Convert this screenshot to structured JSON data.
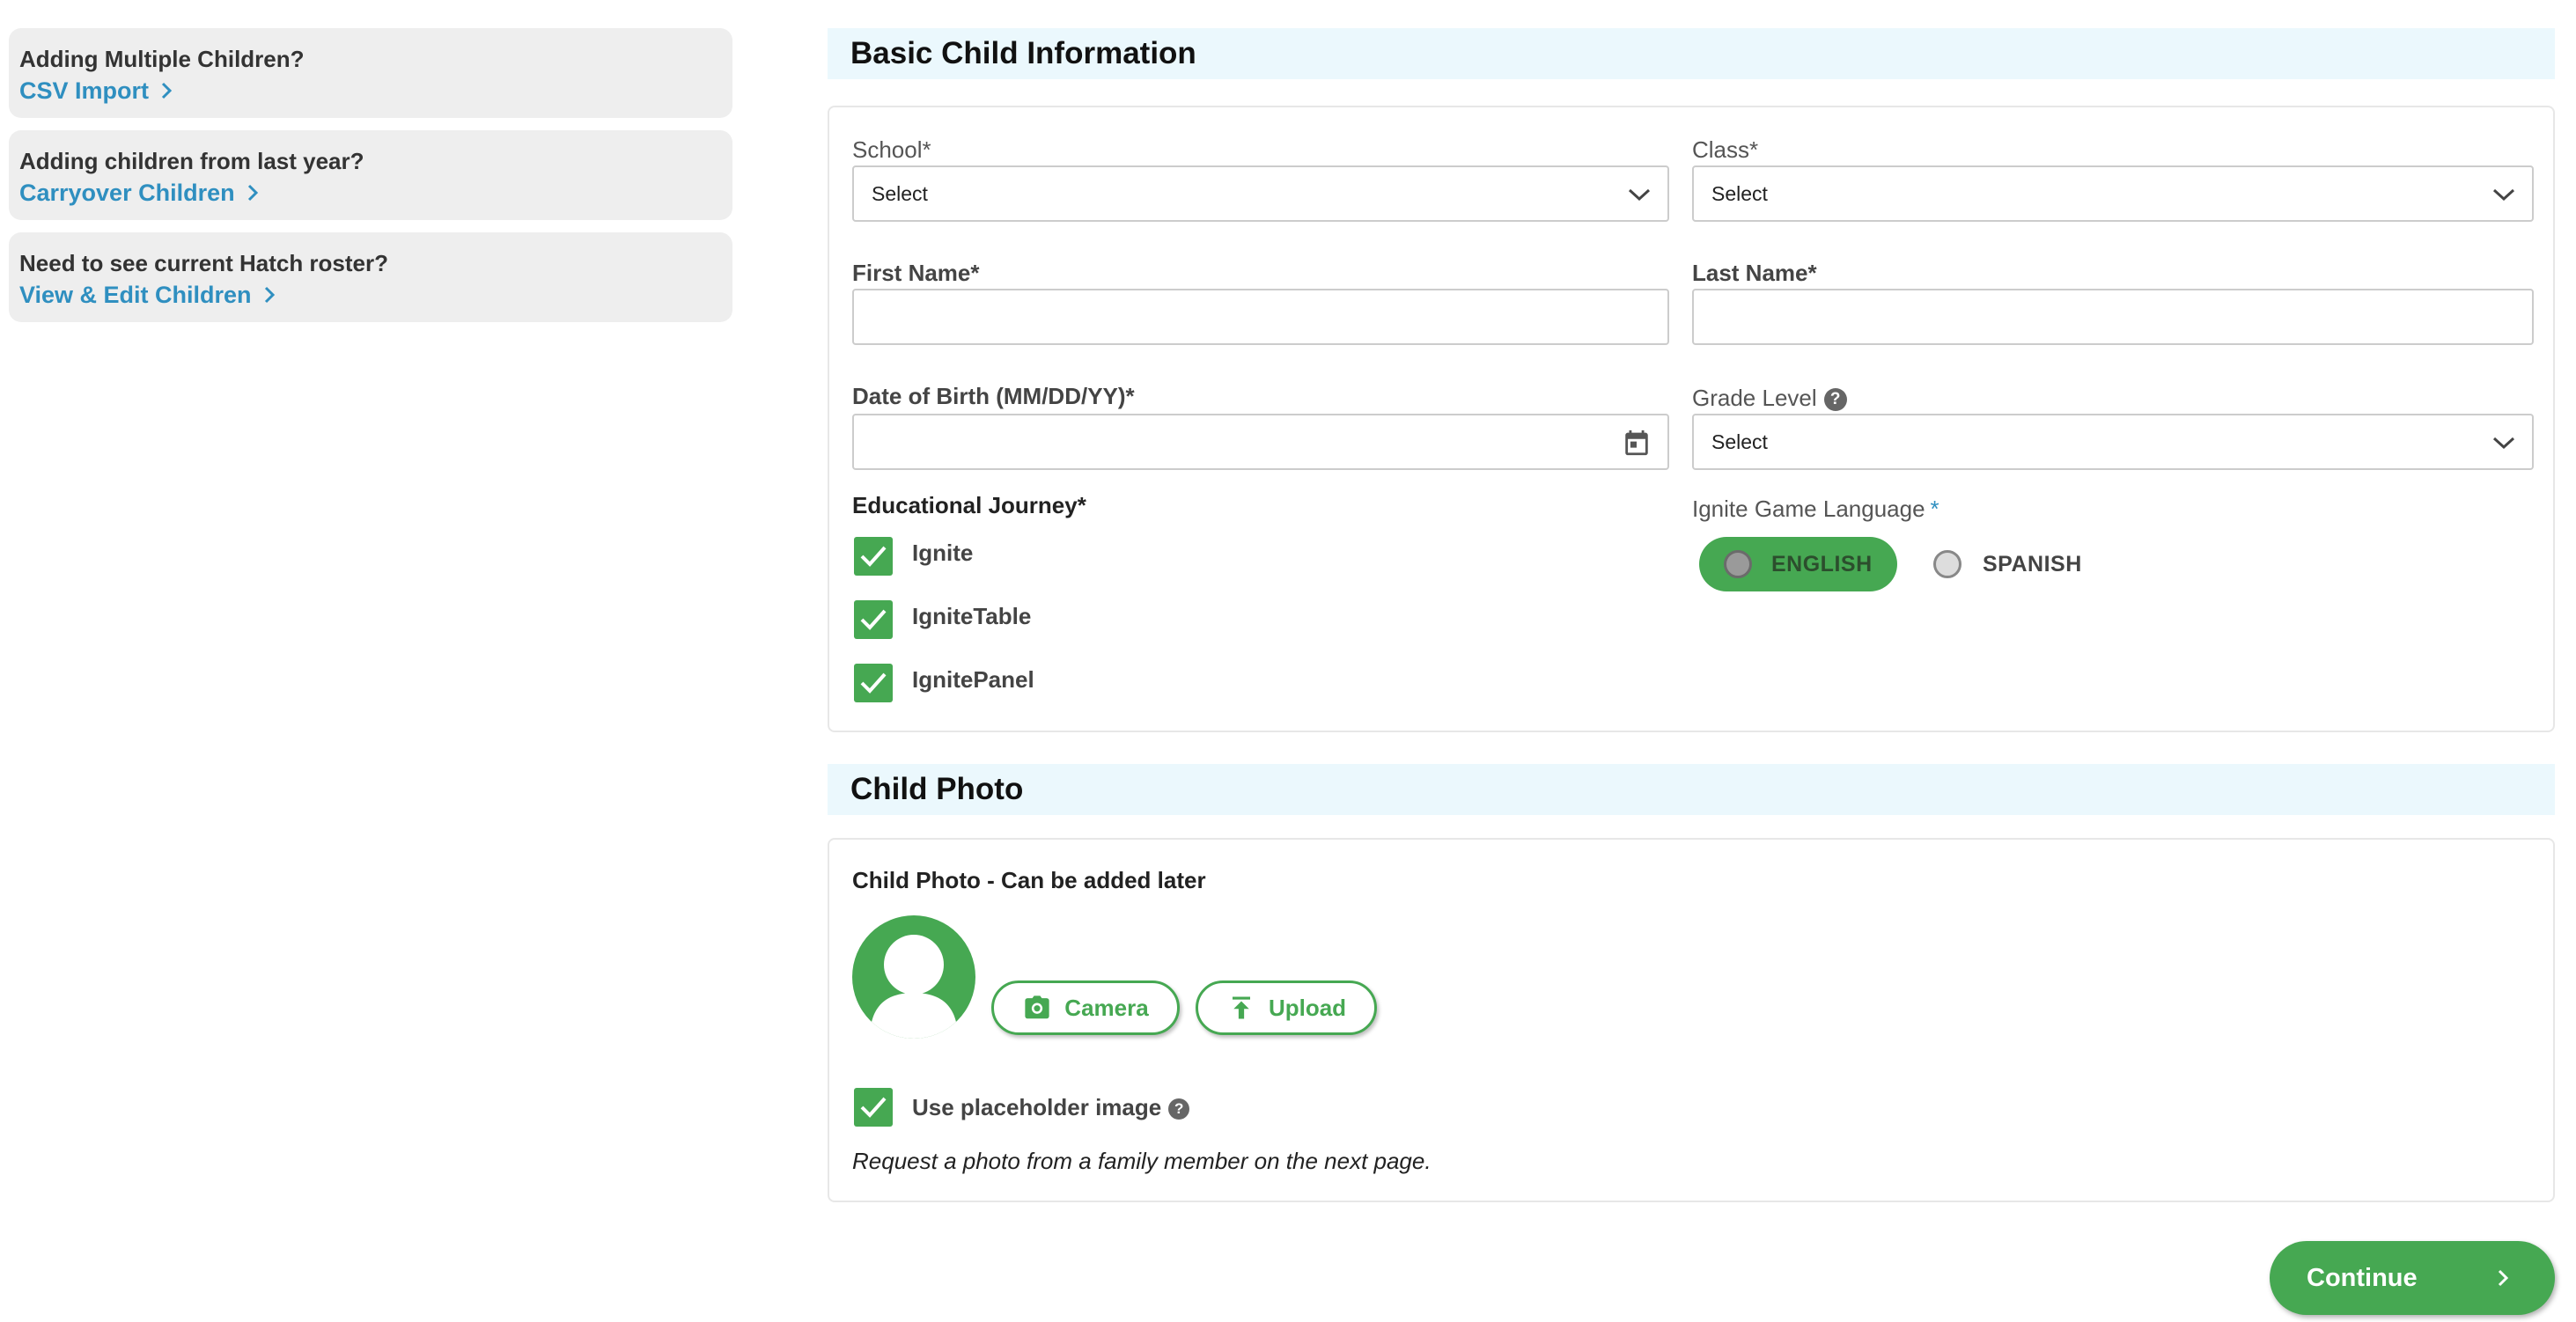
{
  "sidebar": {
    "cards": [
      {
        "question": "Adding Multiple Children?",
        "link": "CSV Import"
      },
      {
        "question": "Adding children from last year?",
        "link": "Carryover Children"
      },
      {
        "question": "Need to see current Hatch roster?",
        "link": "View & Edit Children"
      }
    ]
  },
  "basic_info": {
    "title": "Basic Child Information",
    "school": {
      "label": "School*",
      "value": "Select"
    },
    "class": {
      "label": "Class*",
      "value": "Select"
    },
    "first_name": {
      "label": "First Name*",
      "value": ""
    },
    "last_name": {
      "label": "Last Name*",
      "value": ""
    },
    "dob": {
      "label": "Date of Birth (MM/DD/YY)*",
      "value": ""
    },
    "grade": {
      "label": "Grade Level",
      "value": "Select"
    },
    "journey": {
      "label": "Educational Journey*",
      "options": [
        {
          "label": "Ignite",
          "checked": true
        },
        {
          "label": "IgniteTable",
          "checked": true
        },
        {
          "label": "IgnitePanel",
          "checked": true
        }
      ]
    },
    "language": {
      "label": "Ignite Game Language",
      "required_mark": "*",
      "options": [
        {
          "label": "ENGLISH",
          "selected": true
        },
        {
          "label": "SPANISH",
          "selected": false
        }
      ]
    }
  },
  "photo": {
    "title": "Child Photo",
    "subtitle": "Child Photo - Can be added later",
    "camera_label": "Camera",
    "upload_label": "Upload",
    "placeholder_label": "Use placeholder image",
    "placeholder_checked": true,
    "note": "Request a photo from a family member on the next page."
  },
  "footer": {
    "continue_label": "Continue"
  },
  "colors": {
    "accent_green": "#46a852",
    "link_blue": "#2f8fc0",
    "header_bg": "#ebf8fd",
    "sidebar_bg": "#eeeeee"
  },
  "icons": [
    "chevron-right-icon",
    "chevron-down-icon",
    "calendar-icon",
    "check-icon",
    "help-icon",
    "camera-icon",
    "upload-icon",
    "person-icon"
  ]
}
